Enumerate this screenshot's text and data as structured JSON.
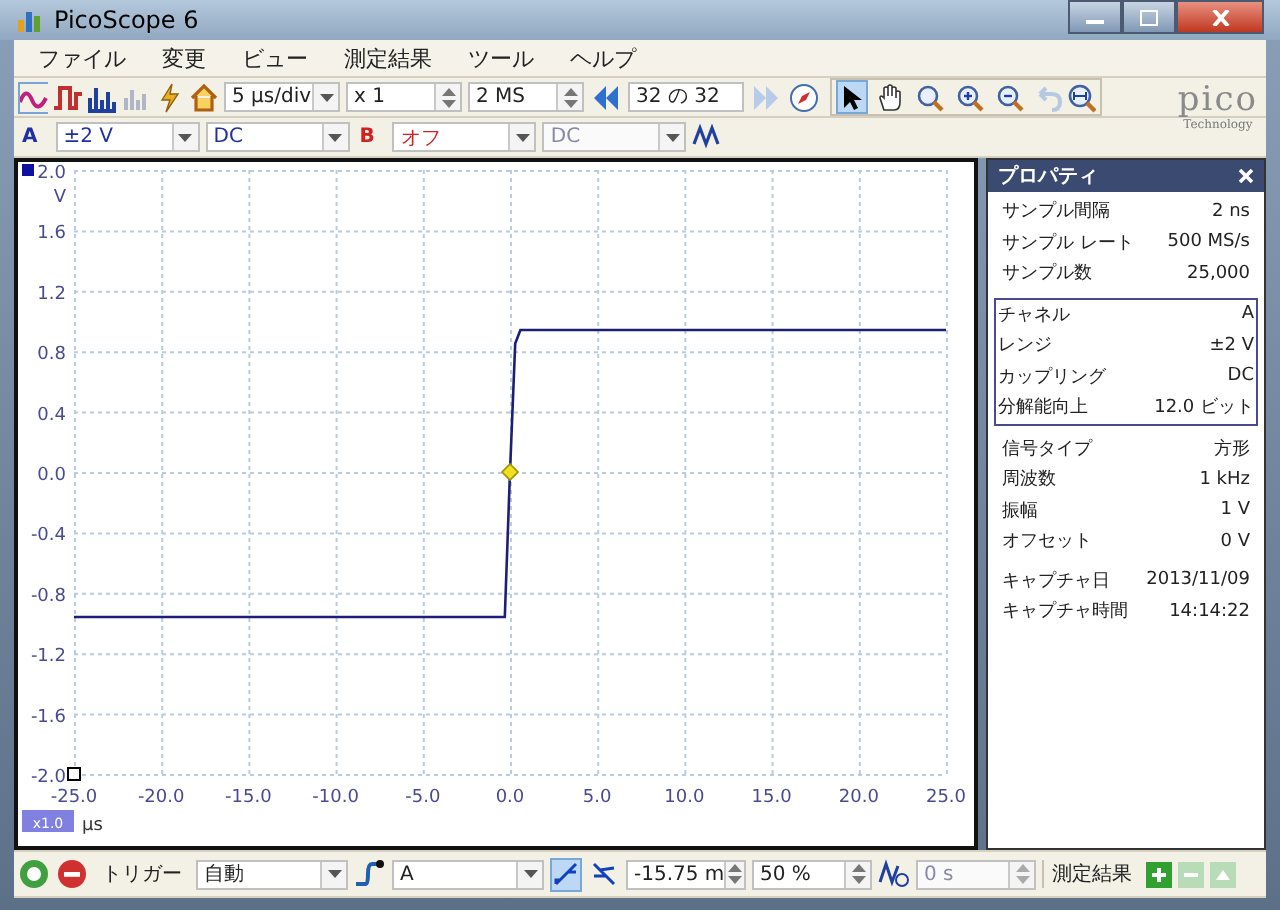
{
  "window": {
    "title": "PicoScope 6"
  },
  "menu": [
    "ファイル",
    "変更",
    "ビュー",
    "測定結果",
    "ツール",
    "ヘルプ"
  ],
  "toolbar": {
    "timebase": "5 µs/div",
    "multiplier": "x 1",
    "samples": "2 MS",
    "buffer": "32 の 32",
    "tools": [
      {
        "kind": "pointer",
        "selected": true
      },
      {
        "kind": "hand",
        "selected": false
      },
      {
        "kind": "zoom",
        "selected": false
      },
      {
        "kind": "zoom-in",
        "selected": false
      },
      {
        "kind": "zoom-out",
        "selected": false
      }
    ]
  },
  "logo": {
    "name": "pico",
    "tagline": "Technology"
  },
  "channels": [
    {
      "label": "A",
      "range": "±2 V",
      "coupling": "DC",
      "disabled": false
    },
    {
      "label": "B",
      "range": "オフ",
      "coupling": "DC",
      "disabled": true
    }
  ],
  "scope": {
    "y_unit": "V",
    "x_unit": "µs",
    "zoom_badge": "x1.0",
    "chart_data": {
      "type": "line",
      "x": [
        -25,
        -0.3,
        0,
        0.3,
        0.6,
        25
      ],
      "grid": true,
      "series": [
        {
          "color": "#1e1e78",
          "values": [
            -0.96,
            -0.96,
            0,
            0.85,
            0.94,
            0.94
          ]
        }
      ],
      "xlim": [
        -25,
        25
      ],
      "ylim": [
        -2,
        2
      ],
      "xticks": [
        {
          "value": -25,
          "label": "-25.0"
        },
        {
          "value": -20,
          "label": "-20.0"
        },
        {
          "value": -15,
          "label": "-15.0"
        },
        {
          "value": -10,
          "label": "-10.0"
        },
        {
          "value": -5,
          "label": "-5.0"
        },
        {
          "value": 0,
          "label": "0.0"
        },
        {
          "value": 5,
          "label": "5.0"
        },
        {
          "value": 10,
          "label": "10.0"
        },
        {
          "value": 15,
          "label": "15.0"
        },
        {
          "value": 20,
          "label": "20.0"
        },
        {
          "value": 25,
          "label": "25.0"
        }
      ],
      "yticks": [
        {
          "value": 2,
          "label": "2.0"
        },
        {
          "value": 1.6,
          "label": "1.6"
        },
        {
          "value": 1.2,
          "label": "1.2"
        },
        {
          "value": 0.8,
          "label": "0.8"
        },
        {
          "value": 0.4,
          "label": "0.4"
        },
        {
          "value": 0,
          "label": "0.0"
        },
        {
          "value": -0.4,
          "label": "-0.4"
        },
        {
          "value": -0.8,
          "label": "-0.8"
        },
        {
          "value": -1.2,
          "label": "-1.2"
        },
        {
          "value": -1.6,
          "label": "-1.6"
        },
        {
          "value": -2,
          "label": "-2.0"
        }
      ]
    }
  },
  "properties": {
    "title": "プロパティ",
    "sections": [
      {
        "kind": "plain",
        "rows": [
          {
            "label": "サンプル間隔",
            "value": "2 ns"
          },
          {
            "label": "サンプル レート",
            "value": "500 MS/s"
          },
          {
            "label": "サンプル数",
            "value": "25,000"
          }
        ]
      },
      {
        "kind": "framed",
        "rows": [
          {
            "label": "チャネル",
            "value": "A"
          },
          {
            "label": "レンジ",
            "value": "±2 V"
          },
          {
            "label": "カップリング",
            "value": "DC"
          },
          {
            "label": "分解能向上",
            "value": "12.0 ビット"
          }
        ]
      },
      {
        "kind": "plain",
        "rows": [
          {
            "label": "信号タイプ",
            "value": "方形"
          },
          {
            "label": "周波数",
            "value": "1 kHz"
          },
          {
            "label": "振幅",
            "value": "1 V"
          },
          {
            "label": "オフセット",
            "value": "0 V"
          }
        ]
      },
      {
        "kind": "plain",
        "rows": [
          {
            "label": "キャプチャ日",
            "value": "2013/11/09"
          },
          {
            "label": "キャプチャ時間",
            "value": "14:14:22"
          }
        ]
      }
    ]
  },
  "trigger": {
    "label": "トリガー",
    "mode": "自動",
    "source": "A",
    "edges": [
      {
        "kind": "rising",
        "selected": true
      },
      {
        "kind": "falling",
        "selected": false
      }
    ],
    "pre_trigger": "-15.75 m",
    "percent": "50 %",
    "delay": "0 s",
    "delay_disabled": true
  },
  "measurements": {
    "label": "測定結果"
  }
}
